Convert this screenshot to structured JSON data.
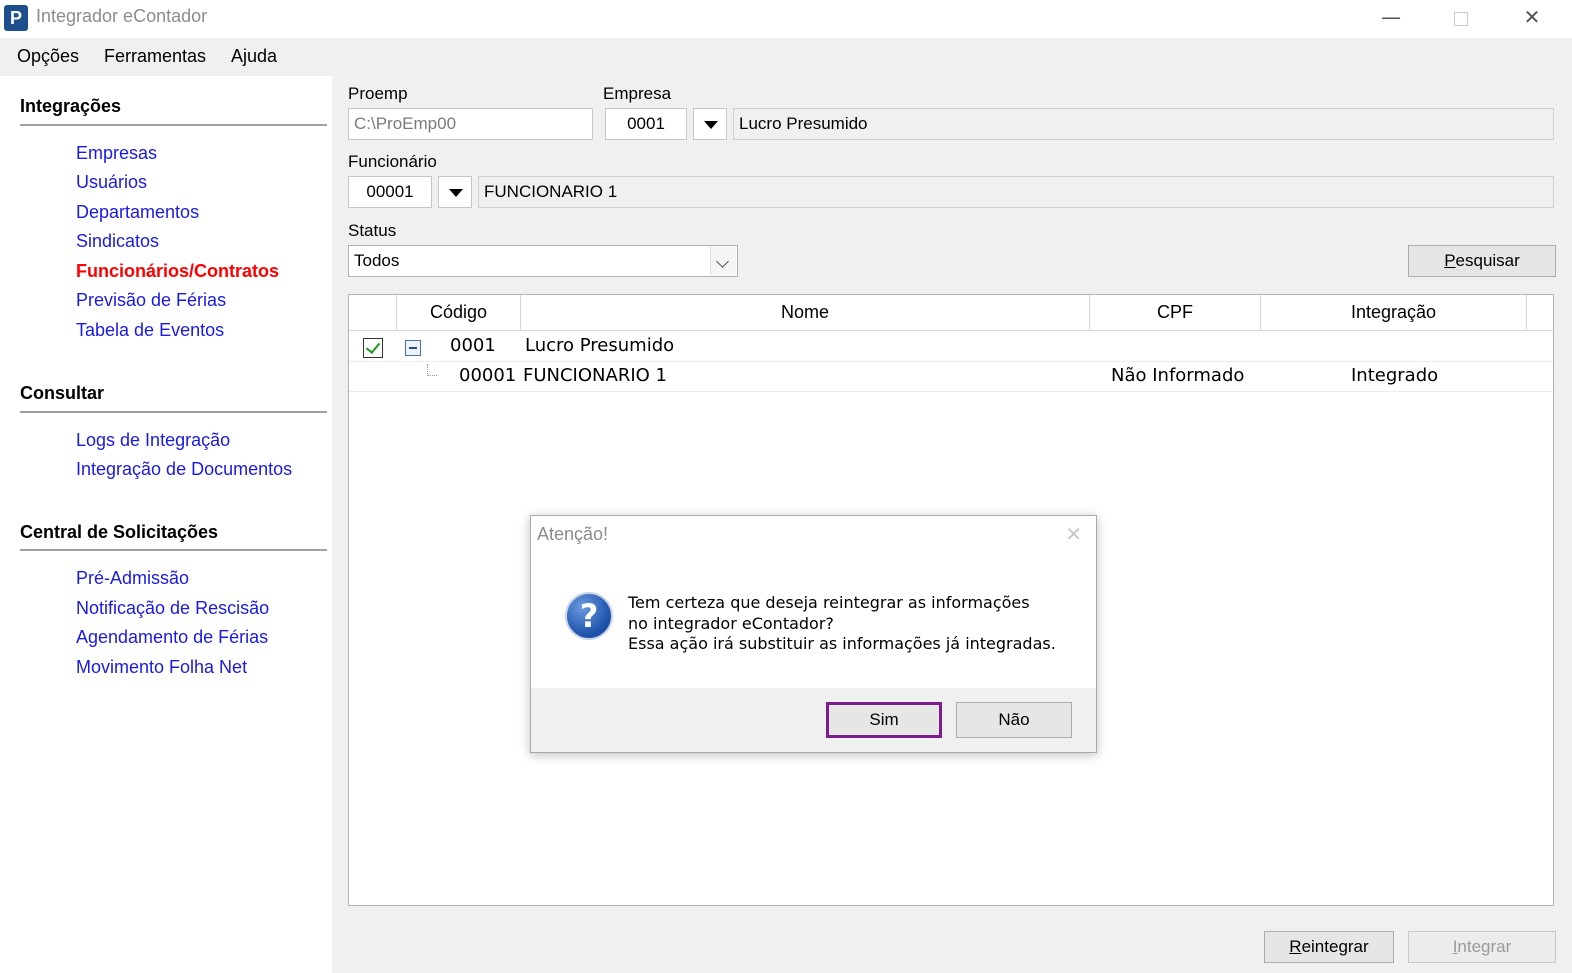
{
  "window": {
    "logo_letter": "P",
    "title": "Integrador eContador",
    "minimize": "—",
    "close": "✕"
  },
  "menu": [
    "Opções",
    "Ferramentas",
    "Ajuda"
  ],
  "sidebar": {
    "sections": [
      {
        "title": "Integrações",
        "items": [
          "Empresas",
          "Usuários",
          "Departamentos",
          "Sindicatos",
          "Funcionários/Contratos",
          "Previsão de Férias",
          "Tabela de Eventos"
        ]
      },
      {
        "title": "Consultar",
        "items": [
          "Logs de Integração",
          "Integração de Documentos"
        ]
      },
      {
        "title": "Central de Solicitações",
        "items": [
          "Pré-Admissão",
          "Notificação de Rescisão",
          "Agendamento de Férias",
          "Movimento Folha Net"
        ]
      }
    ],
    "active_item": "Funcionários/Contratos"
  },
  "form": {
    "proemp_label": "Proemp",
    "proemp_value": "C:\\ProEmp00",
    "empresa_label": "Empresa",
    "empresa_code": "0001",
    "empresa_name": "Lucro Presumido",
    "funcionario_label": "Funcionário",
    "funcionario_code": "00001",
    "funcionario_name": "FUNCIONARIO 1",
    "status_label": "Status",
    "status_value": "Todos",
    "search_button_first": "P",
    "search_button_rest": "esquisar"
  },
  "grid": {
    "columns": [
      "Código",
      "Nome",
      "CPF",
      "Integração"
    ],
    "rows": [
      {
        "checked": true,
        "code": "0001",
        "name": "Lucro Presumido",
        "cpf": "",
        "integracao": ""
      },
      {
        "code": "00001",
        "name": "FUNCIONARIO 1",
        "cpf": "Não Informado",
        "integracao": "Integrado"
      }
    ]
  },
  "footer": {
    "reintegrar_first": "R",
    "reintegrar_rest": "eintegrar",
    "integrar_first": "I",
    "integrar_rest": "ntegrar"
  },
  "dialog": {
    "title": "Atenção!",
    "close": "✕",
    "icon": "?",
    "message_lines": [
      "Tem certeza que deseja reintegrar as informações",
      "no integrador eContador?",
      "Essa ação irá substituir as informações já integradas."
    ],
    "yes_label": "Sim",
    "no_label": "Não"
  },
  "colors": {
    "link": "#1a1ae6",
    "active_link": "#ff0000",
    "focus_border": "#7a1f8a",
    "logo": "#1d4f8c"
  }
}
